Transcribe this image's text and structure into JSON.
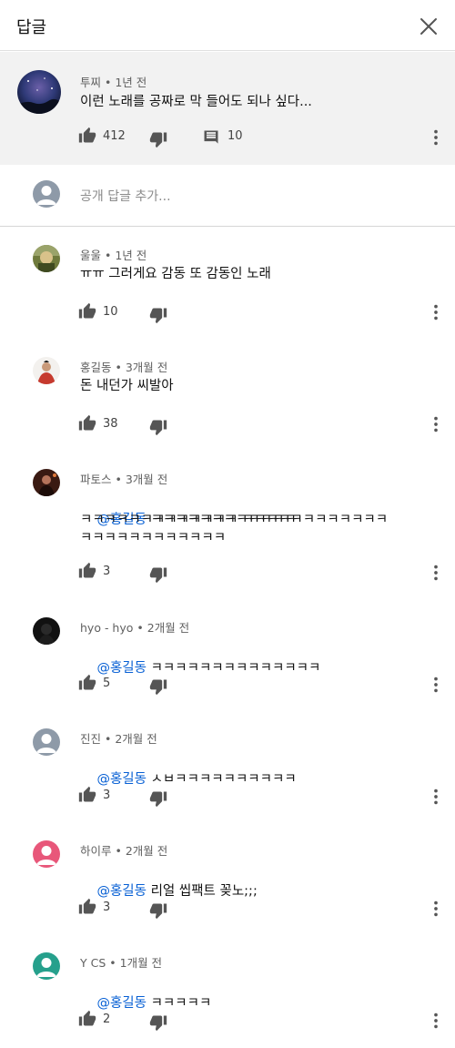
{
  "header": {
    "title": "답글"
  },
  "parent_comment": {
    "author": "투찌",
    "time": "1년 전",
    "text": "이런 노래를 공짜로 막 들어도 되나 싶다...",
    "likes": "412",
    "replies": "10"
  },
  "add_reply": {
    "placeholder": "공개 답글 추가..."
  },
  "replies": [
    {
      "author": "울울",
      "time": "1년 전",
      "mention": "",
      "text": "ㅠㅠ 그러게요 감동 또 감동인 노래",
      "text2": "",
      "text3": "",
      "likes": "10"
    },
    {
      "author": "홍길동",
      "time": "3개월 전",
      "mention": "",
      "text": "돈 내던가 씨발아",
      "text2": "",
      "text3": "",
      "likes": "38"
    },
    {
      "author": "파토스",
      "time": "3개월 전",
      "mention": "@홍길동",
      "text": " ㅋㅋㅋㅋㅋㅋㅋㅋㅋㅋㅋㅋ",
      "text2": "ㅋㅋㅋㅋㅋㅋㅋㅋㅋㅋㅋㅋㅋ ㅋㅋㅋㅋㅋㅋㅋㅋㅋㅋㅋㅋ",
      "text3": "ㅋㅋㅋㅋㅋㅋㅋㅋㅋㅋㅋㅋ",
      "likes": "3"
    },
    {
      "author": "hyo - hyo",
      "time": "2개월 전",
      "mention": "@홍길동",
      "text": " ㅋㅋㅋㅋㅋㅋㅋㅋㅋㅋㅋㅋㅋㅋ",
      "text2": "",
      "text3": "",
      "likes": "5"
    },
    {
      "author": "진진",
      "time": "2개월 전",
      "mention": "@홍길동",
      "text": " ㅅㅂㅋㅋㅋㅋㅋㅋㅋㅋㅋㅋ",
      "text2": "",
      "text3": "",
      "likes": "3"
    },
    {
      "author": "하이루",
      "time": "2개월 전",
      "mention": "@홍길동",
      "text": " 리얼 씹팩트 꽂노;;;",
      "text2": "",
      "text3": "",
      "likes": "3"
    },
    {
      "author": "Y CS",
      "time": "1개월 전",
      "mention": "@홍길동",
      "text": " ㅋㅋㅋㅋㅋ",
      "text2": "",
      "text3": "",
      "likes": "2"
    }
  ],
  "colors": {
    "link": "#065fd4",
    "parent_bg": "#f2f2f2",
    "avatar_gray": "#8e9aa8",
    "avatar_pink": "#e8577a",
    "avatar_teal": "#26a08c"
  },
  "icons": {
    "close": "close-icon",
    "like": "thumbs-up-icon",
    "dislike": "thumbs-down-icon",
    "reply": "comment-icon",
    "more": "more-vertical-icon"
  }
}
